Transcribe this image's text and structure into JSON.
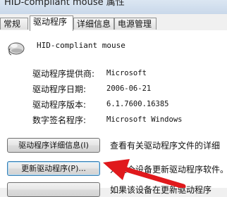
{
  "window": {
    "title": "HID-compliant mouse 属性"
  },
  "tabs": [
    {
      "label": "常规",
      "active": false
    },
    {
      "label": "驱动程序",
      "active": true
    },
    {
      "label": "详细信息",
      "active": false
    },
    {
      "label": "电源管理",
      "active": false
    }
  ],
  "device": {
    "name": "HID-compliant mouse",
    "icon": "mouse-icon"
  },
  "properties": [
    {
      "label": "驱动程序提供商:",
      "value": "Microsoft"
    },
    {
      "label": "驱动程序日期:",
      "value": "2006-06-21"
    },
    {
      "label": "驱动程序版本:",
      "value": "6.1.7600.16385"
    },
    {
      "label": "数字签名程序:",
      "value": "Microsoft Windows"
    }
  ],
  "buttons": [
    {
      "label": "驱动程序详细信息(I)",
      "description": "查看有关驱动程序文件的详细"
    },
    {
      "label": "更新驱动程序(P)...",
      "description": "为这个设备更新驱动程序软件。"
    },
    {
      "label": "",
      "description": "如果该设备在更新驱动程序"
    }
  ],
  "annotation": {
    "arrow_color": "#e0191c"
  },
  "colors": {
    "accent": "#3c7fb1",
    "panel_bg": "#ffffff",
    "window_bg": "#f0f0f0"
  }
}
